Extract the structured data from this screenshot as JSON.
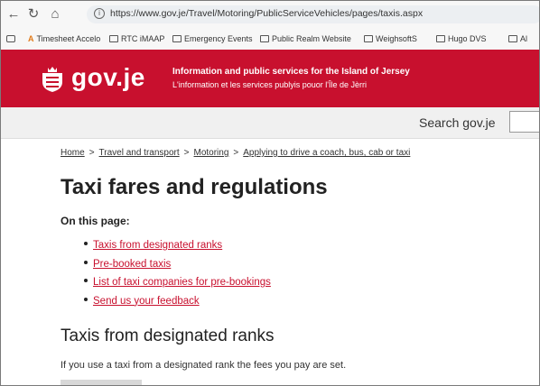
{
  "browser": {
    "url": "https://www.gov.je/Travel/Motoring/PublicServiceVehicles/pages/taxis.aspx",
    "bookmarks": [
      "Timesheet Accelo",
      "RTC iMAAP",
      "Emergency Events",
      "Public Realm Website",
      "WeighsoftS",
      "Hugo DVS",
      "Al"
    ]
  },
  "header": {
    "brand": "gov.je",
    "tagline_en": "Information and public services for the Island of Jersey",
    "tagline_jer": "L'information et les services publyis pouor l'Île de Jèrri",
    "brand_color": "#c8102e"
  },
  "search": {
    "label": "Search gov.je",
    "value": ""
  },
  "breadcrumb": {
    "items": [
      "Home",
      "Travel and transport",
      "Motoring",
      "Applying to drive a coach, bus, cab or taxi"
    ],
    "separator": ">"
  },
  "page": {
    "title": "Taxi fares and regulations",
    "on_this_page": "On this page:",
    "toc": [
      "Taxis from designated ranks",
      "Pre-booked taxis",
      "List of taxi companies for pre-bookings",
      "Send us your feedback"
    ],
    "section_heading": "Taxis from designated ranks",
    "section_text": "If you use a taxi from a designated rank the fees you pay are set."
  }
}
